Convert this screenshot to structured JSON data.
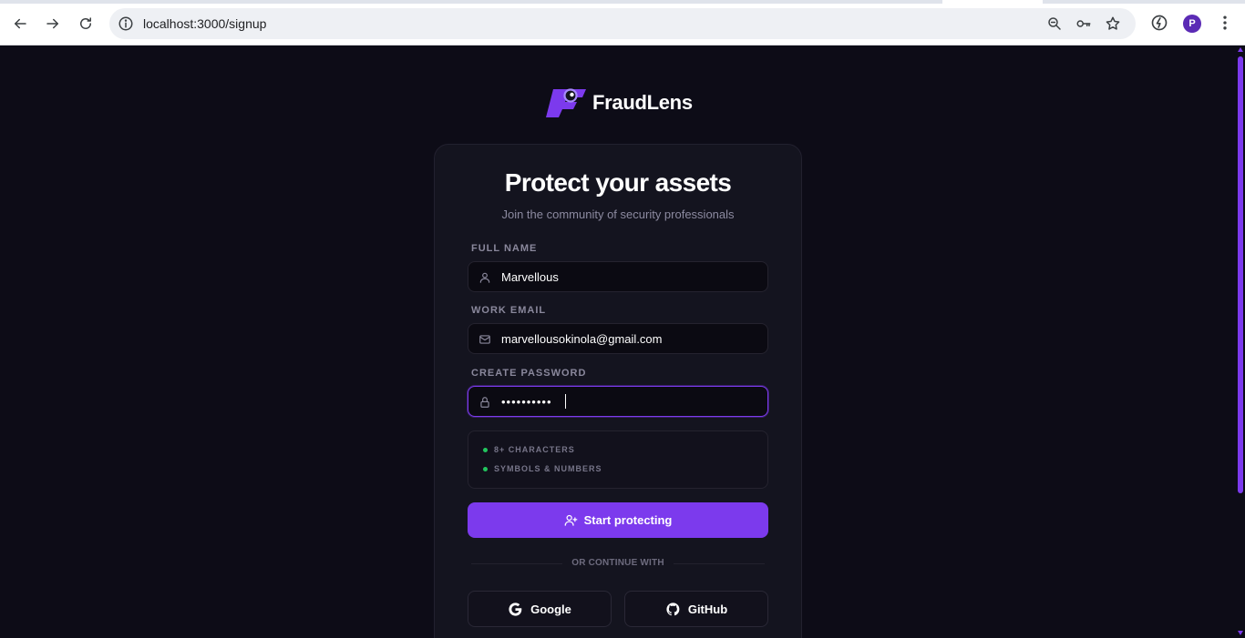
{
  "browser": {
    "url": "localhost:3000/signup",
    "avatar_initial": "P"
  },
  "brand": {
    "name": "FraudLens",
    "accent": "#7c3aed"
  },
  "card": {
    "title": "Protect your assets",
    "subtitle": "Join the community of security professionals"
  },
  "form": {
    "full_name": {
      "label": "FULL NAME",
      "value": "Marvellous",
      "icon": "user-icon"
    },
    "email": {
      "label": "WORK EMAIL",
      "value": "marvellousokinola@gmail.com",
      "icon": "mail-icon"
    },
    "password": {
      "label": "CREATE PASSWORD",
      "value": "••••••••••",
      "icon": "lock-icon"
    }
  },
  "requirements": [
    {
      "label": "8+ CHARACTERS",
      "met_color": "#22c55e"
    },
    {
      "label": "SYMBOLS & NUMBERS",
      "met_color": "#22c55e"
    }
  ],
  "submit_label": "Start protecting",
  "divider_label": "OR CONTINUE WITH",
  "social": {
    "google_label": "Google",
    "github_label": "GitHub"
  }
}
